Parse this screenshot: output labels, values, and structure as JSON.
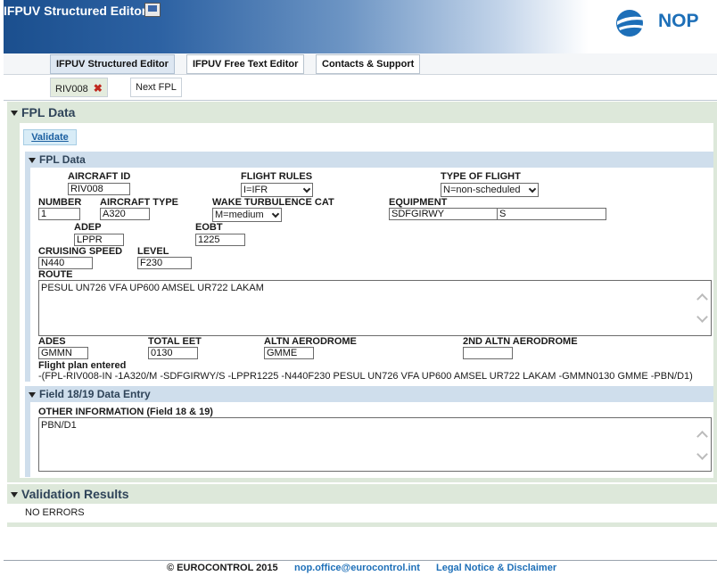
{
  "app": {
    "title": "IFPUV Structured Editor",
    "logo_text": "NOP"
  },
  "nav": {
    "tabs": [
      "IFPUV Structured Editor",
      "IFPUV Free Text Editor",
      "Contacts & Support"
    ]
  },
  "subtabs": {
    "flight": "RIV008",
    "next": "Next FPL"
  },
  "sections": {
    "fpl_data": "FPL Data",
    "fpl_data_inner": "FPL Data",
    "field18": "Field 18/19 Data Entry",
    "validation": "Validation Results"
  },
  "validate_label": "Validate",
  "fields": {
    "aircraft_id": {
      "label": "AIRCRAFT ID",
      "value": "RIV008"
    },
    "flight_rules": {
      "label": "FLIGHT RULES",
      "value": "I=IFR"
    },
    "type_of_flight": {
      "label": "TYPE OF FLIGHT",
      "value": "N=non-scheduled"
    },
    "number": {
      "label": "NUMBER",
      "value": "1"
    },
    "aircraft_type": {
      "label": "AIRCRAFT TYPE",
      "value": "A320"
    },
    "wake": {
      "label": "WAKE TURBULENCE CAT",
      "value": "M=medium"
    },
    "equipment": {
      "label": "EQUIPMENT",
      "value": "SDFGIRWY",
      "value2": "S"
    },
    "adep": {
      "label": "ADEP",
      "value": "LPPR"
    },
    "eobt": {
      "label": "EOBT",
      "value": "1225"
    },
    "cruising_speed": {
      "label": "CRUISING SPEED",
      "value": "N440"
    },
    "level": {
      "label": "LEVEL",
      "value": "F230"
    },
    "route": {
      "label": "ROUTE",
      "value": "PESUL UN726 VFA UP600 AMSEL UR722 LAKAM"
    },
    "ades": {
      "label": "ADES",
      "value": "GMMN"
    },
    "total_eet": {
      "label": "TOTAL EET",
      "value": "0130"
    },
    "altn": {
      "label": "ALTN AERODROME",
      "value": "GMME"
    },
    "altn2": {
      "label": "2ND ALTN AERODROME",
      "value": ""
    },
    "fp_entered": {
      "label": "Flight plan entered",
      "value": "-(FPL-RIV008-IN -1A320/M -SDFGIRWY/S -LPPR1225 -N440F230 PESUL UN726 VFA UP600 AMSEL UR722 LAKAM -GMMN0130 GMME -PBN/D1)"
    },
    "other_info": {
      "label": "OTHER INFORMATION (Field 18 & 19)",
      "value": "PBN/D1"
    }
  },
  "validation_result": "NO ERRORS",
  "footer": {
    "copyright": "© EUROCONTROL 2015",
    "email": "nop.office@eurocontrol.int",
    "legal": "Legal Notice & Disclaimer"
  },
  "colors": {
    "header_blue": "#1b4f8e",
    "link": "#1d6fb8",
    "section_green": "#dde8da",
    "section_blue": "#cfdeec"
  }
}
